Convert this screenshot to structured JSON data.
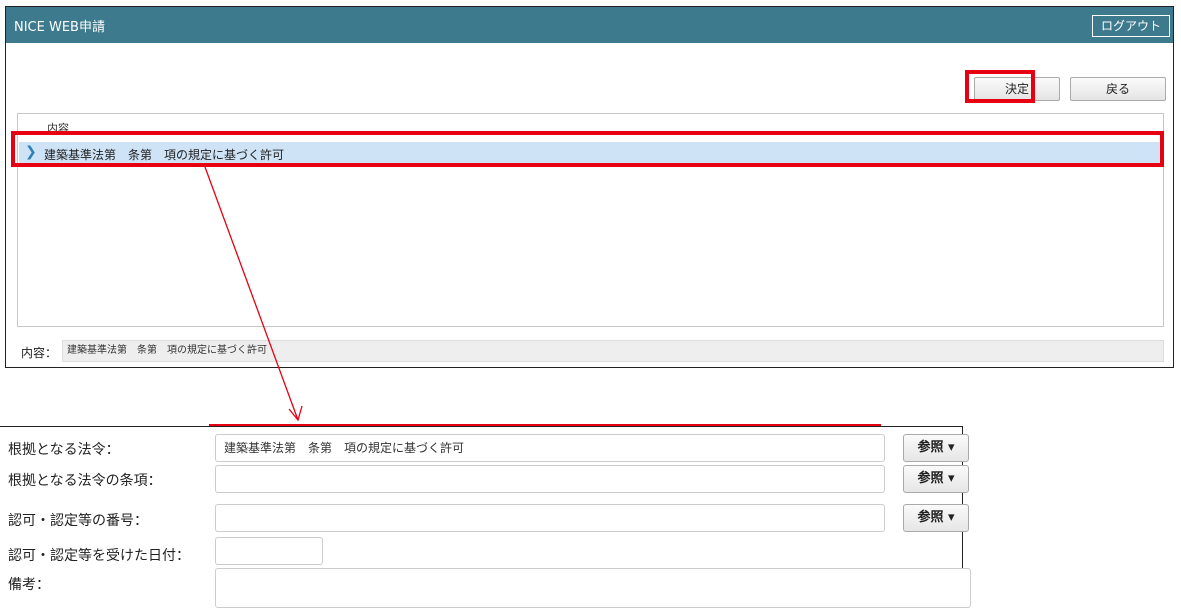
{
  "window": {
    "title": "NICE WEB申請",
    "logout_label": "ログアウト"
  },
  "toolbar": {
    "confirm_label": "決定",
    "back_label": "戻る"
  },
  "list": {
    "column_header": "内容",
    "items": [
      {
        "label": "建築基準法第　条第　項の規定に基づく許可",
        "selected": true
      }
    ]
  },
  "detail": {
    "label": "内容：",
    "value": "建築基準法第　条第　項の規定に基づく許可"
  },
  "form": {
    "fields": [
      {
        "label": "根拠となる法令：",
        "value": "建築基準法第　条第　項の規定に基づく許可",
        "button": "参照"
      },
      {
        "label": "根拠となる法令の条項：",
        "value": "",
        "button": "参照"
      },
      {
        "label": "認可・認定等の番号：",
        "value": "",
        "button": "参照"
      },
      {
        "label": "認可・認定等を受けた日付：",
        "value": ""
      },
      {
        "label": "備考：",
        "value": ""
      }
    ]
  },
  "colors": {
    "titlebar": "#3e7a8e",
    "highlight": "#e60012",
    "selected_row": "#cfe3f7"
  }
}
